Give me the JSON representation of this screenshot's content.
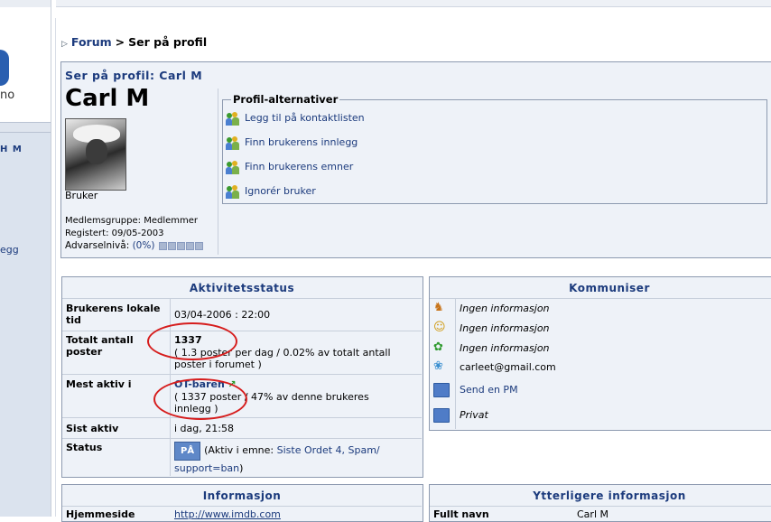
{
  "sidebar": {
    "logo_text": "no",
    "item_1": "H M",
    "item_2": "egg"
  },
  "breadcrumb": {
    "forum": "Forum",
    "separator": ">",
    "current": "Ser på profil"
  },
  "profile": {
    "header": "Ser på profil: Carl M",
    "name": "Carl M",
    "rank": "Bruker",
    "member_group": "Medlemsgruppe: Medlemmer",
    "registered": "Registert: 09/05-2003",
    "warn_label": "Advarselnivå:",
    "warn_value": "(0%)",
    "warn_level_fraction": 0
  },
  "profile_options": {
    "legend": "Profil-alternativer",
    "items": [
      {
        "label": "Legg til på kontaktlisten",
        "icon": "people-icon"
      },
      {
        "label": "Finn brukerens innlegg",
        "icon": "people-icon"
      },
      {
        "label": "Finn brukerens emner",
        "icon": "people-icon"
      },
      {
        "label": "Ignorér bruker",
        "icon": "people-icon"
      }
    ]
  },
  "activity": {
    "title": "Aktivitetsstatus",
    "local_time_label": "Brukerens lokale tid",
    "local_time_value": "03/04-2006 : 22:00",
    "total_posts_label": "Totalt antall poster",
    "total_posts_value": "1337",
    "total_posts_detail": "( 1.3 poster per dag / 0.02% av totalt antall poster i forumet )",
    "most_active_label": "Mest aktiv i",
    "most_active_value": "OT-baren",
    "most_active_detail": "( 1337 poster / 47% av denne brukeres innlegg )",
    "last_active_label": "Sist aktiv",
    "last_active_value": "i dag, 21:58",
    "status_label": "Status",
    "status_badge": "PÅ",
    "status_prefix": "(Aktiv i emne:",
    "status_link": "Siste Ordet 4, Spam/ support=ban",
    "status_suffix": ")"
  },
  "communicate": {
    "title": "Kommuniser",
    "rows": [
      {
        "icon": "aim-icon",
        "text": "Ingen informasjon"
      },
      {
        "icon": "yahoo-icon",
        "text": "Ingen informasjon"
      },
      {
        "icon": "icq-icon",
        "text": "Ingen informasjon"
      },
      {
        "icon": "msn-icon",
        "text": "carleet@gmail.com"
      },
      {
        "icon": "pm-envelope-icon",
        "text": "Send en PM"
      },
      {
        "icon": "email-envelope-icon",
        "text": "Privat"
      }
    ]
  },
  "information": {
    "title": "Informasjon",
    "homepage_label": "Hjemmeside",
    "homepage_value": "http://www.imdb.com"
  },
  "extra_info": {
    "title": "Ytterligere informasjon",
    "fullname_label": "Fullt navn",
    "fullname_value": "Carl M"
  },
  "colors": {
    "link": "#1c3b7d",
    "panel_bg": "#eef2f8",
    "border": "#8d9ab0",
    "annotation_red": "#d61d1d"
  }
}
